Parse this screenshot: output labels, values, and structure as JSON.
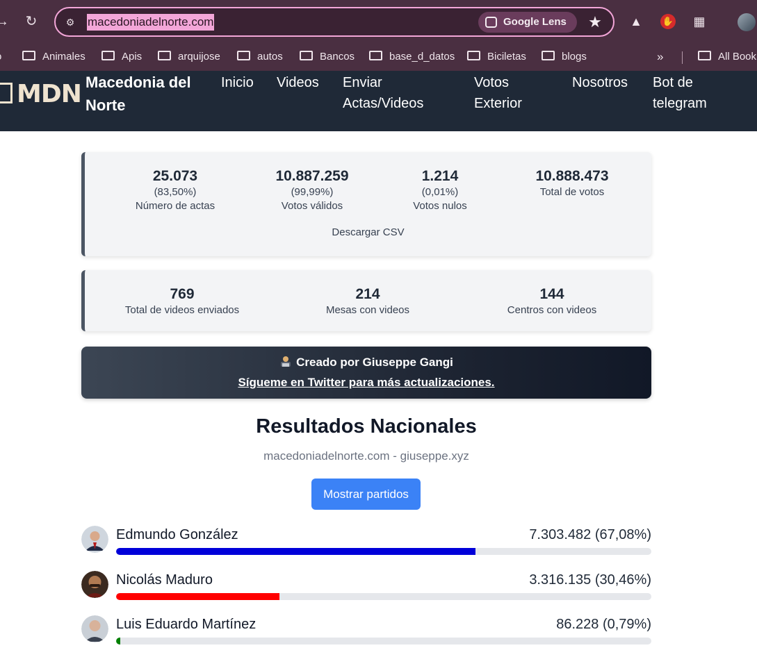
{
  "browser": {
    "url": "macedoniadelnorte.com",
    "lens_label": "Google Lens",
    "bookmarks": [
      {
        "label": "Animales"
      },
      {
        "label": "Apis"
      },
      {
        "label": "arquijose"
      },
      {
        "label": "autos"
      },
      {
        "label": "Bancos"
      },
      {
        "label": "base_d_datos"
      },
      {
        "label": "Biciletas"
      },
      {
        "label": "blogs"
      }
    ],
    "overflow_label": "»",
    "all_bookmarks_label": "All Book"
  },
  "header": {
    "logo_text": "MDN",
    "brand": "Macedonia del Norte",
    "menu": [
      {
        "label": "Inicio"
      },
      {
        "label": "Videos"
      },
      {
        "label": "Enviar Actas/Videos"
      },
      {
        "label": "Votos Exterior"
      },
      {
        "label": "Nosotros"
      },
      {
        "label": "Bot de telegram"
      }
    ]
  },
  "stats": [
    {
      "value": "25.073",
      "pct": "(83,50%)",
      "label": "Número de actas"
    },
    {
      "value": "10.887.259",
      "pct": "(99,99%)",
      "label": "Votos válidos"
    },
    {
      "value": "1.214",
      "pct": "(0,01%)",
      "label": "Votos nulos"
    },
    {
      "value": "10.888.473",
      "pct": "",
      "label": "Total de votos"
    }
  ],
  "csv_label": "Descargar CSV",
  "video_stats": [
    {
      "value": "769",
      "label": "Total de videos enviados"
    },
    {
      "value": "214",
      "label": "Mesas con videos"
    },
    {
      "value": "144",
      "label": "Centros con videos"
    }
  ],
  "banner": {
    "line1": "Creado por Giuseppe Gangi",
    "line2": "Sígueme en Twitter para más actualizaciones."
  },
  "results": {
    "title": "Resultados Nacionales",
    "subtitle": "macedoniadelnorte.com - giuseppe.xyz",
    "toggle_label": "Mostrar partidos",
    "candidates": [
      {
        "name": "Edmundo González",
        "votes": "7.303.482 (67,08%)",
        "share": 67.08,
        "color": "#0000d9"
      },
      {
        "name": "Nicolás Maduro",
        "votes": "3.316.135 (30,46%)",
        "share": 30.46,
        "color": "#ff0000"
      },
      {
        "name": "Luis Eduardo Martínez",
        "votes": "86.228 (0,79%)",
        "share": 0.79,
        "color": "#008000"
      }
    ]
  }
}
